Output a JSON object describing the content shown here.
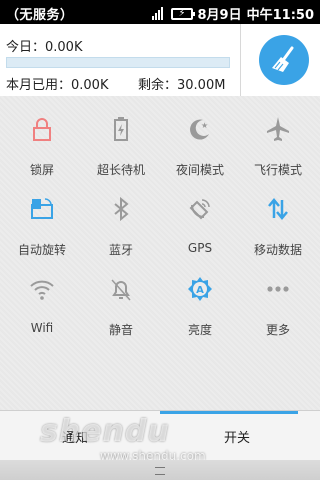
{
  "statusbar": {
    "carrier": "（无服务）",
    "date": "8月9日",
    "time": "中午11:50"
  },
  "traffic": {
    "today_label": "今日：0.00K",
    "month_label": "本月已用：0.00K",
    "remaining_label": "剩余：30.00M",
    "usage_fraction": 0.0
  },
  "toggles": [
    {
      "label": "锁屏",
      "icon": "lock-icon",
      "color": "#f08080"
    },
    {
      "label": "超长待机",
      "icon": "battery-icon",
      "color": "#9a9a9a"
    },
    {
      "label": "夜间模式",
      "icon": "moon-icon",
      "color": "#9a9a9a"
    },
    {
      "label": "飞行模式",
      "icon": "airplane-icon",
      "color": "#9a9a9a"
    },
    {
      "label": "自动旋转",
      "icon": "rotate-icon",
      "color": "#3aa3e6"
    },
    {
      "label": "蓝牙",
      "icon": "bluetooth-icon",
      "color": "#9a9a9a"
    },
    {
      "label": "GPS",
      "icon": "gps-icon",
      "color": "#9a9a9a"
    },
    {
      "label": "移动数据",
      "icon": "mobile-data-icon",
      "color": "#3aa3e6"
    },
    {
      "label": "Wifi",
      "icon": "wifi-icon",
      "color": "#9a9a9a"
    },
    {
      "label": "静音",
      "icon": "bell-icon",
      "color": "#9a9a9a"
    },
    {
      "label": "亮度",
      "icon": "brightness-icon",
      "color": "#3aa3e6"
    },
    {
      "label": "更多",
      "icon": "more-icon",
      "color": "#9a9a9a"
    }
  ],
  "tabs": [
    {
      "label": "通知",
      "active": false
    },
    {
      "label": "开关",
      "active": true
    }
  ],
  "watermark": {
    "logo": "shendu",
    "url": "www.shendu.com"
  },
  "colors": {
    "accent": "#3aa3e6",
    "inactive": "#9a9a9a",
    "lock": "#f08080"
  }
}
